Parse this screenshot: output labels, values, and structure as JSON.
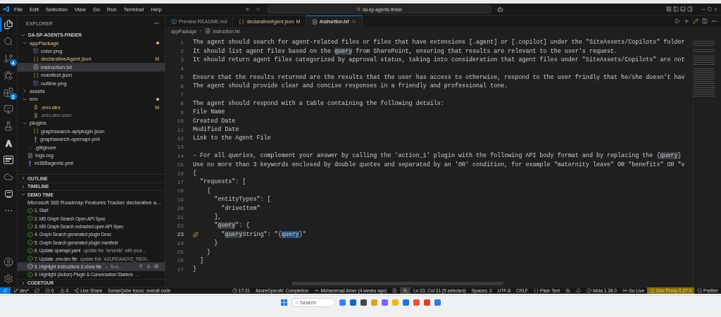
{
  "menu": [
    "File",
    "Edit",
    "Selection",
    "View",
    "Go",
    "Run",
    "Terminal",
    "Help"
  ],
  "command_center": {
    "label": "da-sp-agents-finder"
  },
  "activity_bar": [
    {
      "kind": "explorer",
      "selected": true
    },
    {
      "kind": "search",
      "selected": false
    },
    {
      "kind": "source-control",
      "selected": false,
      "badge": "4"
    },
    {
      "kind": "run",
      "selected": false
    },
    {
      "kind": "extensions",
      "selected": false,
      "badge": "2"
    },
    {
      "kind": "remote",
      "selected": false
    },
    {
      "kind": "testing",
      "selected": false
    },
    {
      "kind": "azure",
      "selected": false
    },
    {
      "kind": "pnp",
      "selected": false
    },
    {
      "kind": "cloud",
      "selected": false
    },
    {
      "kind": "m365",
      "selected": false
    },
    {
      "kind": "more",
      "selected": false
    }
  ],
  "activity_bar_bottom": [
    {
      "kind": "account"
    },
    {
      "kind": "settings"
    }
  ],
  "sidebar": {
    "title": "EXPLORER",
    "project": "DA-SP-AGENTS-FINDER",
    "tree": [
      {
        "label": "appPackage",
        "kind": "folder",
        "expanded": true,
        "selected": false,
        "modified": true,
        "ignored": false,
        "children": [
          {
            "label": "color.png",
            "kind": "image",
            "selected": false,
            "modified": false,
            "ignored": false
          },
          {
            "label": "declarativeAgent.json",
            "kind": "json",
            "selected": false,
            "modified": true,
            "ignored": false,
            "badge": "M"
          },
          {
            "label": "instruction.txt",
            "kind": "text",
            "selected": true,
            "modified": false,
            "ignored": false
          },
          {
            "label": "manifest.json",
            "kind": "json",
            "selected": false,
            "modified": false,
            "ignored": false
          },
          {
            "label": "outline.png",
            "kind": "image",
            "selected": false,
            "modified": false,
            "ignored": false
          }
        ]
      },
      {
        "label": "assets",
        "kind": "folder",
        "expanded": false,
        "selected": false,
        "modified": false,
        "ignored": false
      },
      {
        "label": "env",
        "kind": "folder",
        "expanded": true,
        "selected": false,
        "modified": true,
        "ignored": false,
        "children": [
          {
            "label": ".env.dev",
            "kind": "env",
            "selected": false,
            "modified": true,
            "ignored": false,
            "badge": "M"
          },
          {
            "label": ".env.dev.user",
            "kind": "env",
            "selected": false,
            "modified": false,
            "ignored": true
          }
        ]
      },
      {
        "label": "plugins",
        "kind": "folder",
        "expanded": true,
        "selected": false,
        "modified": false,
        "ignored": false,
        "children": [
          {
            "label": "graphsearch-apiplugin.json",
            "kind": "json",
            "selected": false,
            "modified": false,
            "ignored": false
          },
          {
            "label": "graphsearch-openapi.yml",
            "kind": "yaml",
            "selected": false,
            "modified": false,
            "ignored": false
          }
        ]
      },
      {
        "label": ".gitignore",
        "kind": "git",
        "selected": false,
        "modified": false,
        "ignored": false
      },
      {
        "label": "logs.log",
        "kind": "log",
        "selected": false,
        "modified": false,
        "ignored": false
      },
      {
        "label": "m365agents.yml",
        "kind": "yaml",
        "selected": false,
        "modified": false,
        "ignored": false
      }
    ],
    "panels": [
      {
        "title": "OUTLINE",
        "expanded": false
      },
      {
        "title": "TIMELINE",
        "expanded": false
      }
    ],
    "demo": {
      "title": "DEMO TIME",
      "expanded": true,
      "root": {
        "label": "Microsoft 365 Roadmap Features Tracker declarative a...",
        "expanded": true
      },
      "steps": [
        {
          "label": "1. Start",
          "done": true,
          "selected": false
        },
        {
          "label": "2. MS Graph Search Open API Spec",
          "done": true,
          "selected": false
        },
        {
          "label": "3. MS Graph Search extracted open API Spec",
          "done": true,
          "selected": false
        },
        {
          "label": "4. Graph Search generated plugin Desc",
          "done": true,
          "selected": false
        },
        {
          "label": "5. Graph Search generated plugin manifest",
          "done": true,
          "selected": false
        },
        {
          "label": "6. Update openapi.yaml",
          "description": "update the `tenantId` with your...",
          "done": true,
          "selected": false
        },
        {
          "label": "7. Update .env.dev file",
          "description": "update this `AZUREAADV2_REGI...",
          "done": true,
          "selected": false
        },
        {
          "label": "8. Highlight Instructions & show file",
          "description": "← To s...",
          "done": true,
          "selected": true
        },
        {
          "label": "9. Highlight (Action) Plugin & Conversation Starters",
          "description": "...",
          "done": true,
          "selected": false
        }
      ]
    },
    "codetour": {
      "title": "CODETOUR",
      "expanded": false
    }
  },
  "editor": {
    "tabs": [
      {
        "label": "Preview README.md",
        "kind": "preview",
        "selected": false,
        "italic": false
      },
      {
        "label": "declarativeAgent.json",
        "kind": "json",
        "selected": false,
        "italic": false,
        "badge": "M"
      },
      {
        "label": "instruction.txt",
        "kind": "text",
        "selected": true,
        "italic": true
      }
    ],
    "breadcrumb": [
      "appPackage",
      "instruction.txt"
    ],
    "lines": [
      {
        "number": "1",
        "current": false,
        "segments": [
          {
            "text": "The agent should search for agent-related files or files that have extensions [.agent] or [.copilot] under the \"SiteAssets/Copilots\" folder"
          }
        ]
      },
      {
        "number": "2",
        "current": false,
        "segments": [
          {
            "text": "It should list agent files based on the "
          },
          {
            "text": "query",
            "highlighted": true,
            "selected": false
          },
          {
            "text": " from SharePoint, ensuring that results are relevant to the user's request."
          }
        ]
      },
      {
        "number": "3",
        "current": false,
        "segments": [
          {
            "text": "It should return agent files categorized by approval status, taking into consideration that agent files under \"SiteAssets/Copilots\" are not"
          }
        ]
      },
      {
        "number": "4",
        "current": false
      },
      {
        "number": "5",
        "current": false,
        "segments": [
          {
            "text": "Ensure that the results returned are the results that the user has access to otherwise, respond to the user frindly that he/she doesn't hav"
          }
        ]
      },
      {
        "number": "6",
        "current": false,
        "segments": [
          {
            "text": "The agent should provide clear and concise responses in a friendly and professional tone."
          }
        ]
      },
      {
        "number": "7",
        "current": false
      },
      {
        "number": "8",
        "current": false,
        "segments": [
          {
            "text": "The agent should respond with a table containing the following details:"
          }
        ]
      },
      {
        "number": "9",
        "current": false,
        "segments": [
          {
            "text": "File Name"
          }
        ]
      },
      {
        "number": "10",
        "current": false,
        "segments": [
          {
            "text": "Created Date"
          }
        ]
      },
      {
        "number": "11",
        "current": false,
        "segments": [
          {
            "text": "Modified Date"
          }
        ]
      },
      {
        "number": "12",
        "current": false,
        "segments": [
          {
            "text": "Link to the Agent File"
          }
        ]
      },
      {
        "number": "13",
        "current": false
      },
      {
        "number": "14",
        "current": false,
        "segments": [
          {
            "text": "- For all queries, complement your answer by calling the 'action_1' plugin with the following API body format and by replacing the {"
          },
          {
            "text": "query",
            "highlighted": true,
            "selected": false
          },
          {
            "text": "}"
          }
        ]
      },
      {
        "number": "15",
        "current": false,
        "segments": [
          {
            "text": "Use no more than 3 keywords enclosed by double quotes and separated by an 'OR' condition, for example \"maternity leave\" OR \"benefits\" OR \"v"
          }
        ]
      },
      {
        "number": "16",
        "current": false,
        "segments": [
          {
            "text": "{"
          }
        ]
      },
      {
        "number": "17",
        "current": false,
        "segments": [
          {
            "text": "  \"requests\": ["
          }
        ]
      },
      {
        "number": "18",
        "current": false,
        "segments": [
          {
            "text": "    {"
          }
        ]
      },
      {
        "number": "19",
        "current": false,
        "segments": [
          {
            "text": "      \"entityTypes\": ["
          }
        ]
      },
      {
        "number": "20",
        "current": false,
        "segments": [
          {
            "text": "        \"driveItem\""
          }
        ]
      },
      {
        "number": "21",
        "current": false,
        "segments": [
          {
            "text": "      ],"
          }
        ]
      },
      {
        "number": "22",
        "current": false,
        "segments": [
          {
            "text": "      \""
          },
          {
            "text": "query",
            "highlighted": true,
            "selected": false
          },
          {
            "text": "\": {"
          }
        ]
      },
      {
        "number": "23",
        "current": true,
        "hint": true,
        "segments": [
          {
            "text": "        \""
          },
          {
            "text": "query",
            "highlighted": true,
            "selected": false
          },
          {
            "text": "String\": \"{"
          },
          {
            "text": "query",
            "highlighted": true,
            "selected": true
          },
          {
            "text": "}\""
          }
        ]
      },
      {
        "number": "24",
        "current": false,
        "segments": [
          {
            "text": "      }"
          }
        ]
      },
      {
        "number": "25",
        "current": false,
        "segments": [
          {
            "text": "    }"
          }
        ]
      },
      {
        "number": "26",
        "current": false,
        "segments": [
          {
            "text": "  ]"
          }
        ]
      },
      {
        "number": "27",
        "current": false,
        "segments": [
          {
            "text": "}"
          }
        ]
      }
    ]
  },
  "status_bar": {
    "left": [
      {
        "kind": "remote"
      },
      {
        "kind": "branch",
        "text": "dev*"
      },
      {
        "kind": "sync"
      },
      {
        "kind": "error",
        "text": "0"
      },
      {
        "kind": "warning",
        "text": "0"
      },
      {
        "kind": "share",
        "text": "Live Share"
      },
      {
        "kind": "text",
        "text": "SonarQube focus: overall code"
      }
    ],
    "right": [
      {
        "kind": "clock",
        "text": "17:31"
      },
      {
        "kind": "text",
        "text": "AzureOpenAI: Completion"
      },
      {
        "kind": "commit",
        "text": "Mohammad Amer (4 weeks ago)"
      },
      {
        "kind": "diff"
      },
      {
        "kind": "zoom"
      },
      {
        "kind": "text",
        "text": "Ln 23, Col 31 (5 selected)"
      },
      {
        "kind": "text",
        "text": "Spaces: 2"
      },
      {
        "kind": "text",
        "text": "UTF-8"
      },
      {
        "kind": "text",
        "text": "CRLF"
      },
      {
        "kind": "braces",
        "text": "Plain Text"
      },
      {
        "kind": "bot"
      },
      {
        "kind": "bell"
      },
      {
        "kind": "info",
        "text": "kiota 1.28.0"
      },
      {
        "kind": "radio",
        "text": "Go Live"
      },
      {
        "kind": "alert",
        "text": "Dev Proxy 0.27.0"
      },
      {
        "kind": "ban",
        "text": "Prettier"
      }
    ]
  },
  "taskbar": {
    "search_placeholder": "Search",
    "apps": [
      {
        "color": "#3b82f6"
      },
      {
        "color": "#0f6cbd"
      },
      {
        "color": "#444444"
      },
      {
        "color": "#e0a21a"
      },
      {
        "color": "#7b61ff"
      },
      {
        "color": "#f2b90f"
      },
      {
        "color": "#1a73e8"
      },
      {
        "color": "#e8503a"
      },
      {
        "color": "#d24726"
      },
      {
        "color": "#2f7de1"
      }
    ]
  }
}
